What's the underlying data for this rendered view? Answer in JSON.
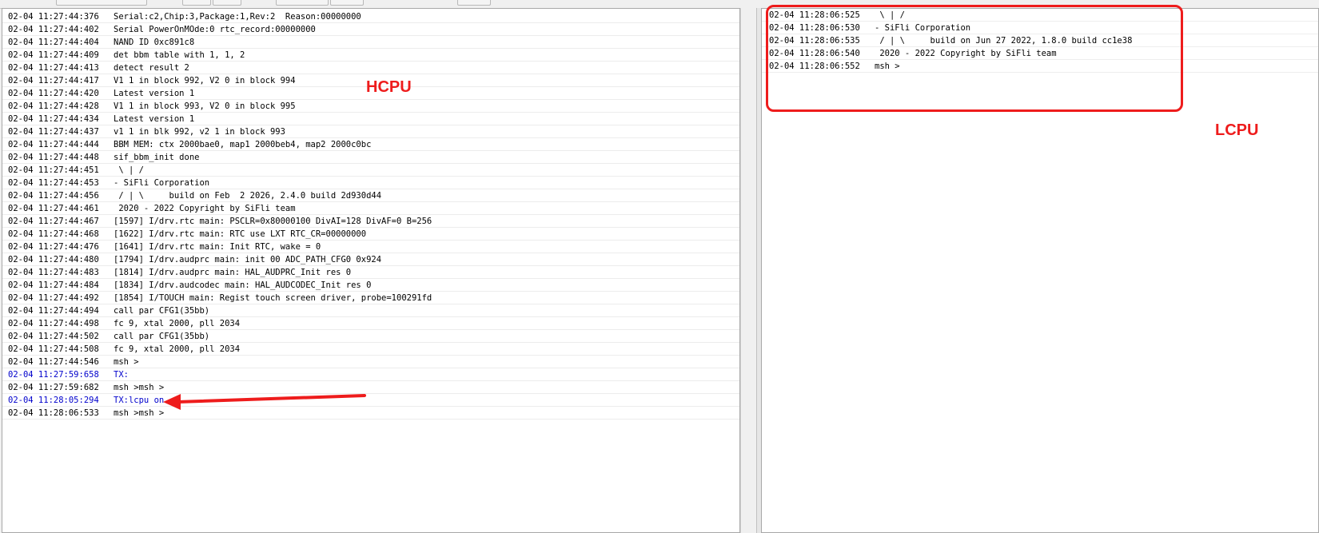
{
  "hcpu": {
    "label": "HCPU",
    "lines": [
      {
        "ts": "02-04 11:27:44:376",
        "msg": "Serial:c2,Chip:3,Package:1,Rev:2  Reason:00000000",
        "tx": false
      },
      {
        "ts": "02-04 11:27:44:402",
        "msg": "Serial PowerOnMOde:0 rtc_record:00000000",
        "tx": false
      },
      {
        "ts": "02-04 11:27:44:404",
        "msg": "NAND ID 0xc891c8",
        "tx": false
      },
      {
        "ts": "02-04 11:27:44:409",
        "msg": "det bbm table with 1, 1, 2",
        "tx": false
      },
      {
        "ts": "02-04 11:27:44:413",
        "msg": "detect result 2",
        "tx": false
      },
      {
        "ts": "02-04 11:27:44:417",
        "msg": "V1 1 in block 992, V2 0 in block 994",
        "tx": false
      },
      {
        "ts": "02-04 11:27:44:420",
        "msg": "Latest version 1",
        "tx": false
      },
      {
        "ts": "02-04 11:27:44:428",
        "msg": "V1 1 in block 993, V2 0 in block 995",
        "tx": false
      },
      {
        "ts": "02-04 11:27:44:434",
        "msg": "Latest version 1",
        "tx": false
      },
      {
        "ts": "02-04 11:27:44:437",
        "msg": "v1 1 in blk 992, v2 1 in block 993",
        "tx": false
      },
      {
        "ts": "02-04 11:27:44:444",
        "msg": "BBM MEM: ctx 2000bae0, map1 2000beb4, map2 2000c0bc",
        "tx": false
      },
      {
        "ts": "02-04 11:27:44:448",
        "msg": "sif_bbm_init done",
        "tx": false
      },
      {
        "ts": "02-04 11:27:44:451",
        "msg": " \\ | /",
        "tx": false
      },
      {
        "ts": "02-04 11:27:44:453",
        "msg": "- SiFli Corporation",
        "tx": false
      },
      {
        "ts": "02-04 11:27:44:456",
        "msg": " / | \\     build on Feb  2 2026, 2.4.0 build 2d930d44",
        "tx": false
      },
      {
        "ts": "02-04 11:27:44:461",
        "msg": " 2020 - 2022 Copyright by SiFli team",
        "tx": false
      },
      {
        "ts": "02-04 11:27:44:467",
        "msg": "[1597] I/drv.rtc main: PSCLR=0x80000100 DivAI=128 DivAF=0 B=256",
        "tx": false
      },
      {
        "ts": "02-04 11:27:44:468",
        "msg": "[1622] I/drv.rtc main: RTC use LXT RTC_CR=00000000",
        "tx": false
      },
      {
        "ts": "02-04 11:27:44:476",
        "msg": "[1641] I/drv.rtc main: Init RTC, wake = 0",
        "tx": false
      },
      {
        "ts": "02-04 11:27:44:480",
        "msg": "[1794] I/drv.audprc main: init 00 ADC_PATH_CFG0 0x924",
        "tx": false
      },
      {
        "ts": "02-04 11:27:44:483",
        "msg": "[1814] I/drv.audprc main: HAL_AUDPRC_Init res 0",
        "tx": false
      },
      {
        "ts": "02-04 11:27:44:484",
        "msg": "[1834] I/drv.audcodec main: HAL_AUDCODEC_Init res 0",
        "tx": false
      },
      {
        "ts": "02-04 11:27:44:492",
        "msg": "[1854] I/TOUCH main: Regist touch screen driver, probe=100291fd",
        "tx": false
      },
      {
        "ts": "02-04 11:27:44:494",
        "msg": "call par CFG1(35bb)",
        "tx": false
      },
      {
        "ts": "02-04 11:27:44:498",
        "msg": "fc 9, xtal 2000, pll 2034",
        "tx": false
      },
      {
        "ts": "02-04 11:27:44:502",
        "msg": "call par CFG1(35bb)",
        "tx": false
      },
      {
        "ts": "02-04 11:27:44:508",
        "msg": "fc 9, xtal 2000, pll 2034",
        "tx": false
      },
      {
        "ts": "02-04 11:27:44:546",
        "msg": "msh >",
        "tx": false
      },
      {
        "ts": "02-04 11:27:59:658",
        "msg": "TX:",
        "tx": true
      },
      {
        "ts": "02-04 11:27:59:682",
        "msg": "msh >msh >",
        "tx": false
      },
      {
        "ts": "02-04 11:28:05:294",
        "msg": "TX:lcpu on",
        "tx": true
      },
      {
        "ts": "02-04 11:28:06:533",
        "msg": "msh >msh >",
        "tx": false
      }
    ]
  },
  "lcpu": {
    "label": "LCPU",
    "lines": [
      {
        "ts": "02-04 11:28:06:525",
        "msg": " \\ | /",
        "tx": false
      },
      {
        "ts": "02-04 11:28:06:530",
        "msg": "- SiFli Corporation",
        "tx": false
      },
      {
        "ts": "02-04 11:28:06:535",
        "msg": " / | \\     build on Jun 27 2022, 1.8.0 build cc1e38",
        "tx": false
      },
      {
        "ts": "02-04 11:28:06:540",
        "msg": " 2020 - 2022 Copyright by SiFli team",
        "tx": false
      },
      {
        "ts": "02-04 11:28:06:552",
        "msg": "msh >",
        "tx": false
      }
    ]
  },
  "colors": {
    "annotation": "#ee1c1c",
    "tx_text": "#0000cc"
  }
}
